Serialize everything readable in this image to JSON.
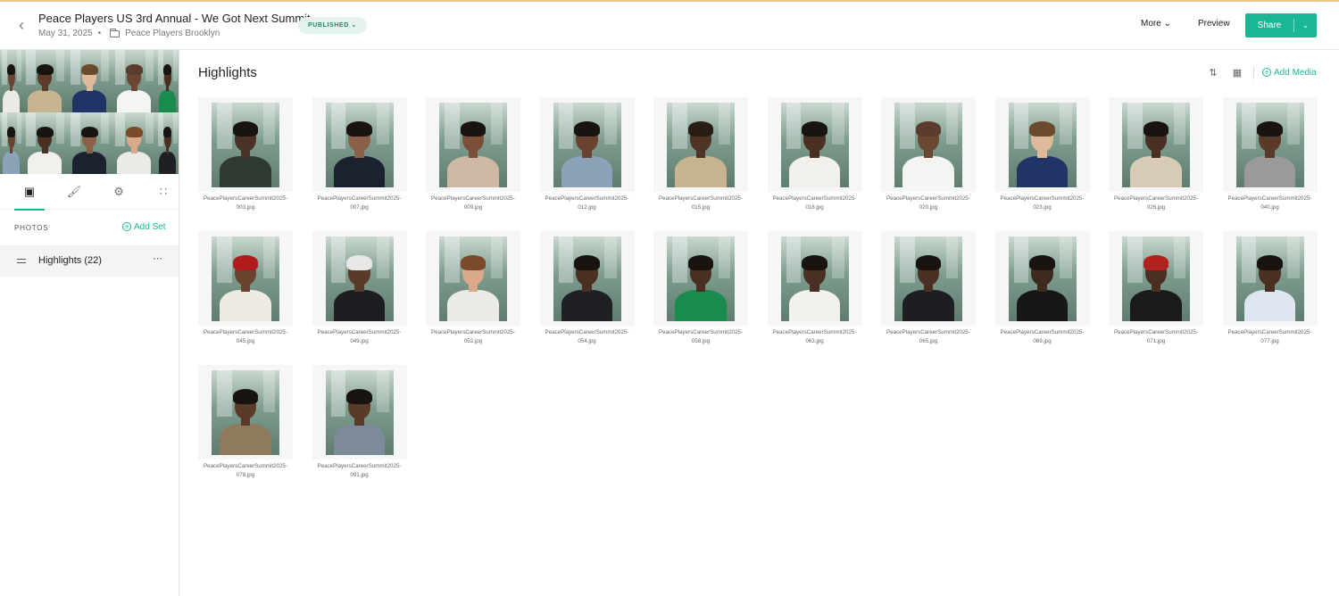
{
  "header": {
    "title": "Peace Players US 3rd Annual - We Got Next Summit",
    "date": "May 31, 2025",
    "separator": "•",
    "folder": "Peace Players Brooklyn",
    "status": "PUBLISHED",
    "more_label": "More",
    "preview_label": "Preview",
    "share_label": "Share"
  },
  "sidebar": {
    "section_label": "PHOTOS",
    "add_set_label": "Add Set",
    "sets": [
      {
        "label": "Highlights (22)"
      }
    ]
  },
  "main": {
    "title": "Highlights",
    "add_media_label": "Add Media"
  },
  "colors": {
    "accent": "#17b893",
    "badge_bg": "#e3f3ee",
    "badge_text": "#1a8a6c"
  },
  "photos": [
    {
      "name1": "PeacePlayersCareerSummit2025-",
      "name2": "003.jpg",
      "skin": "#4a3326",
      "top": "#2f3a33",
      "hair": "#1a1410"
    },
    {
      "name1": "PeacePlayersCareerSummit2025-",
      "name2": "007.jpg",
      "skin": "#8a6148",
      "top": "#1c2130",
      "hair": "#1a1410"
    },
    {
      "name1": "PeacePlayersCareerSummit2025-",
      "name2": "009.jpg",
      "skin": "#7a5038",
      "top": "#cdb9a3",
      "hair": "#1a1410"
    },
    {
      "name1": "PeacePlayersCareerSummit2025-",
      "name2": "012.jpg",
      "skin": "#6a4330",
      "top": "#8aa3b8",
      "hair": "#1a1410"
    },
    {
      "name1": "PeacePlayersCareerSummit2025-",
      "name2": "015.jpg",
      "skin": "#4f3324",
      "top": "#c8b391",
      "hair": "#2a1d15"
    },
    {
      "name1": "PeacePlayersCareerSummit2025-",
      "name2": "018.jpg",
      "skin": "#4a3022",
      "top": "#f2f0ea",
      "hair": "#1a1410"
    },
    {
      "name1": "PeacePlayersCareerSummit2025-",
      "name2": "020.jpg",
      "skin": "#6b4632",
      "top": "#f4f4f2",
      "hair": "#5a3d2c"
    },
    {
      "name1": "PeacePlayersCareerSummit2025-",
      "name2": "023.jpg",
      "skin": "#e0b89a",
      "top": "#1e3566",
      "hair": "#6a4a2c"
    },
    {
      "name1": "PeacePlayersCareerSummit2025-",
      "name2": "026.jpg",
      "skin": "#4a3022",
      "top": "#d8cbb6",
      "hair": "#1a1410"
    },
    {
      "name1": "PeacePlayersCareerSummit2025-",
      "name2": "040.jpg",
      "skin": "#5a3a28",
      "top": "#9a9a9a",
      "hair": "#1a1410"
    },
    {
      "name1": "PeacePlayersCareerSummit2025-",
      "name2": "045.jpg",
      "skin": "#6a4430",
      "top": "#eeeae2",
      "hair": "#b01c1c"
    },
    {
      "name1": "PeacePlayersCareerSummit2025-",
      "name2": "049.jpg",
      "skin": "#5a3a28",
      "top": "#1e1e22",
      "hair": "#e8e8e8"
    },
    {
      "name1": "PeacePlayersCareerSummit2025-",
      "name2": "052.jpg",
      "skin": "#d9a98a",
      "top": "#eceae6",
      "hair": "#7a4a2a"
    },
    {
      "name1": "PeacePlayersCareerSummit2025-",
      "name2": "054.jpg",
      "skin": "#4a3022",
      "top": "#1e2024",
      "hair": "#1a1410"
    },
    {
      "name1": "PeacePlayersCareerSummit2025-",
      "name2": "058.jpg",
      "skin": "#4a3022",
      "top": "#1a8a4e",
      "hair": "#1a1410"
    },
    {
      "name1": "PeacePlayersCareerSummit2025-",
      "name2": "063.jpg",
      "skin": "#4a3022",
      "top": "#f3f1ec",
      "hair": "#1a1410"
    },
    {
      "name1": "PeacePlayersCareerSummit2025-",
      "name2": "065.jpg",
      "skin": "#4a3022",
      "top": "#1c1e22",
      "hair": "#1a1410"
    },
    {
      "name1": "PeacePlayersCareerSummit2025-",
      "name2": "069.jpg",
      "skin": "#3f2a1e",
      "top": "#17171a",
      "hair": "#1a1410"
    },
    {
      "name1": "PeacePlayersCareerSummit2025-",
      "name2": "071.jpg",
      "skin": "#4a3022",
      "top": "#1a1a1c",
      "hair": "#b32020"
    },
    {
      "name1": "PeacePlayersCareerSummit2025-",
      "name2": "077.jpg",
      "skin": "#4a3022",
      "top": "#dfe6f0",
      "hair": "#1a1410"
    },
    {
      "name1": "PeacePlayersCareerSummit2025-",
      "name2": "078.jpg",
      "skin": "#5a3a28",
      "top": "#8f7a5e",
      "hair": "#1a1410"
    },
    {
      "name1": "PeacePlayersCareerSummit2025-",
      "name2": "091.jpg",
      "skin": "#5a3a28",
      "top": "#7d8a99",
      "hair": "#1a1410"
    }
  ],
  "cover_tiles": [
    {
      "skin": "#6a4330",
      "top": "#eceae6",
      "hair": "#1a1410"
    },
    {
      "skin": "#5a3a28",
      "top": "#c8b391",
      "hair": "#1a1410"
    },
    {
      "skin": "#e0b89a",
      "top": "#1e3566",
      "hair": "#6a4a2c"
    },
    {
      "skin": "#6b4632",
      "top": "#f4f4f2",
      "hair": "#5a3d2c"
    },
    {
      "skin": "#4a3022",
      "top": "#1a8a4e",
      "hair": "#1a1410"
    },
    {
      "skin": "#6a4430",
      "top": "#8aa3b8",
      "hair": "#1a1410"
    },
    {
      "skin": "#4a3022",
      "top": "#f2f0ea",
      "hair": "#1a1410"
    },
    {
      "skin": "#8a6148",
      "top": "#1c2130",
      "hair": "#1a1410"
    },
    {
      "skin": "#d9a98a",
      "top": "#eceae6",
      "hair": "#7a4a2a"
    },
    {
      "skin": "#4a3022",
      "top": "#1e2024",
      "hair": "#1a1410"
    }
  ]
}
